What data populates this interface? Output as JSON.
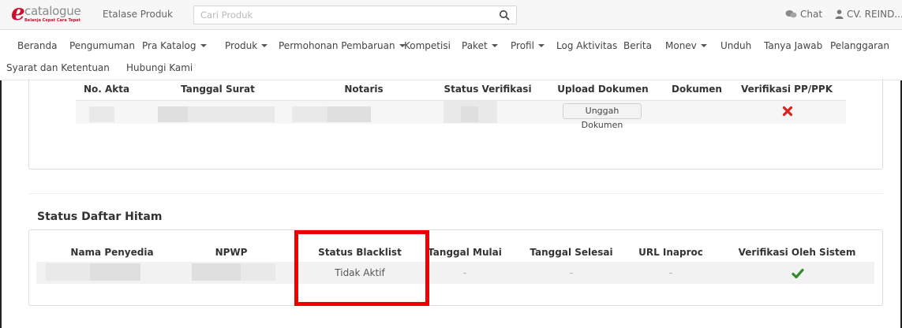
{
  "header": {
    "logo_word": "catalogue",
    "logo_tagline": "Belanja Cepat Cara Tepat",
    "etalase_label": "Etalase Produk",
    "search_placeholder": "Cari Produk",
    "chat_label": "Chat",
    "user_label": "CV. REIND..."
  },
  "nav": {
    "items": [
      {
        "label": "Beranda"
      },
      {
        "label": "Pengumuman"
      },
      {
        "label": "Pra Katalog"
      },
      {
        "label": "Produk"
      },
      {
        "label": "Permohonan Pembaruan"
      },
      {
        "label": "Kompetisi"
      },
      {
        "label": "Paket"
      },
      {
        "label": "Profil"
      },
      {
        "label": "Log Aktivitas"
      },
      {
        "label": "Berita"
      },
      {
        "label": "Monev"
      },
      {
        "label": "Unduh"
      },
      {
        "label": "Tanya Jawab"
      },
      {
        "label": "Pelanggaran"
      },
      {
        "label": "Syarat dan Ketentuan"
      },
      {
        "label": "Hubungi Kami"
      }
    ]
  },
  "akta_table": {
    "headers": [
      "No. Akta",
      "Tanggal Surat",
      "Notaris",
      "Status Verifikasi",
      "Upload Dokumen",
      "Dokumen",
      "Verifikasi PP/PPK"
    ],
    "upload_button": "Unggah Dokumen",
    "verifikasi_icon": "x-mark-icon",
    "verifikasi_color": "#d9231d"
  },
  "blacklist": {
    "title": "Status Daftar Hitam",
    "headers": [
      "Nama Penyedia",
      "NPWP",
      "Status Blacklist",
      "Tanggal Mulai",
      "Tanggal Selesai",
      "URL Inaproc",
      "Verifikasi Oleh Sistem"
    ],
    "row": {
      "status_blacklist": "Tidak Aktif",
      "tanggal_mulai": "-",
      "tanggal_selesai": "-",
      "url_inaproc": "-",
      "verifikasi_icon": "check-icon",
      "verifikasi_color": "#2e8b2e"
    }
  },
  "colors": {
    "brand_red": "#c8102e",
    "highlight": "#ee0000"
  }
}
